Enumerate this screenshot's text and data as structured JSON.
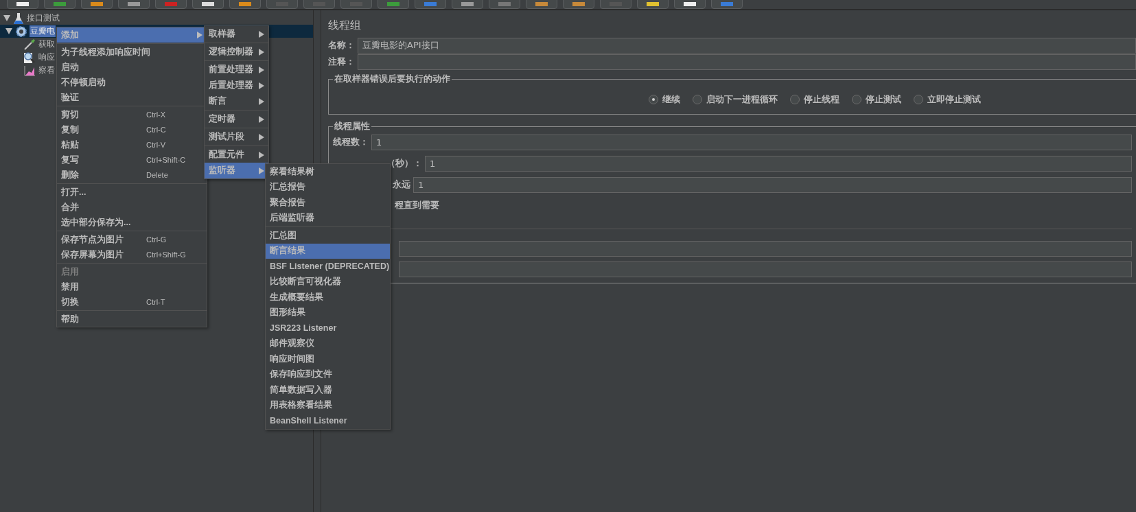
{
  "tree": {
    "root": {
      "label": "接口测试",
      "expanded": true,
      "children": [
        {
          "label": "豆瓣电",
          "selected": true,
          "expanded": true,
          "kind": "gear",
          "children": [
            {
              "label": "获取",
              "kind": "pipette",
              "selected": false
            },
            {
              "label": "响应",
              "kind": "magnifier",
              "selected": false
            },
            {
              "label": "察看",
              "kind": "graph",
              "selected": false
            }
          ]
        }
      ]
    }
  },
  "context_menu": {
    "groups": [
      [
        {
          "label": "添加",
          "has_submenu": true,
          "selected": true,
          "disabled": false
        }
      ],
      [
        {
          "label": "为子线程添加响应时间",
          "has_submenu": false,
          "selected": false,
          "disabled": false
        },
        {
          "label": "启动",
          "has_submenu": false,
          "selected": false,
          "disabled": false
        },
        {
          "label": "不停顿启动",
          "has_submenu": false,
          "selected": false,
          "disabled": false
        },
        {
          "label": "验证",
          "has_submenu": false,
          "selected": false,
          "disabled": false
        }
      ],
      [
        {
          "label": "剪切",
          "shortcut": "Ctrl-X",
          "has_submenu": false,
          "selected": false,
          "disabled": false
        },
        {
          "label": "复制",
          "shortcut": "Ctrl-C",
          "has_submenu": false,
          "selected": false,
          "disabled": false
        },
        {
          "label": "粘贴",
          "shortcut": "Ctrl-V",
          "has_submenu": false,
          "selected": false,
          "disabled": false
        },
        {
          "label": "复写",
          "shortcut": "Ctrl+Shift-C",
          "has_submenu": false,
          "selected": false,
          "disabled": false
        },
        {
          "label": "删除",
          "shortcut": "Delete",
          "has_submenu": false,
          "selected": false,
          "disabled": false
        }
      ],
      [
        {
          "label": "打开...",
          "has_submenu": false,
          "selected": false,
          "disabled": false
        },
        {
          "label": "合并",
          "has_submenu": false,
          "selected": false,
          "disabled": false
        },
        {
          "label": "选中部分保存为...",
          "has_submenu": false,
          "selected": false,
          "disabled": false
        }
      ],
      [
        {
          "label": "保存节点为图片",
          "shortcut": "Ctrl-G",
          "has_submenu": false,
          "selected": false,
          "disabled": false
        },
        {
          "label": "保存屏幕为图片",
          "shortcut": "Ctrl+Shift-G",
          "has_submenu": false,
          "selected": false,
          "disabled": false
        }
      ],
      [
        {
          "label": "启用",
          "has_submenu": false,
          "selected": false,
          "disabled": true
        },
        {
          "label": "禁用",
          "has_submenu": false,
          "selected": false,
          "disabled": false
        },
        {
          "label": "切换",
          "shortcut": "Ctrl-T",
          "has_submenu": false,
          "selected": false,
          "disabled": false
        }
      ],
      [
        {
          "label": "帮助",
          "has_submenu": false,
          "selected": false,
          "disabled": false
        }
      ]
    ]
  },
  "add_submenu": {
    "groups": [
      [
        {
          "label": "取样器",
          "has_submenu": true,
          "selected": false
        }
      ],
      [
        {
          "label": "逻辑控制器",
          "has_submenu": true,
          "selected": false
        }
      ],
      [
        {
          "label": "前置处理器",
          "has_submenu": true,
          "selected": false
        },
        {
          "label": "后置处理器",
          "has_submenu": true,
          "selected": false
        },
        {
          "label": "断言",
          "has_submenu": true,
          "selected": false
        }
      ],
      [
        {
          "label": "定时器",
          "has_submenu": true,
          "selected": false
        }
      ],
      [
        {
          "label": "测试片段",
          "has_submenu": true,
          "selected": false
        }
      ],
      [
        {
          "label": "配置元件",
          "has_submenu": true,
          "selected": false
        },
        {
          "label": "监听器",
          "has_submenu": true,
          "selected": true
        }
      ]
    ]
  },
  "listener_submenu": {
    "groups": [
      [
        {
          "label": "察看结果树",
          "selected": false
        },
        {
          "label": "汇总报告",
          "selected": false
        },
        {
          "label": "聚合报告",
          "selected": false
        },
        {
          "label": "后端监听器",
          "selected": false
        }
      ],
      [
        {
          "label": "汇总图",
          "selected": false
        },
        {
          "label": "断言结果",
          "selected": true
        },
        {
          "label": "BSF Listener (DEPRECATED)",
          "selected": false
        },
        {
          "label": "比较断言可视化器",
          "selected": false
        },
        {
          "label": "生成概要结果",
          "selected": false
        },
        {
          "label": "图形结果",
          "selected": false
        },
        {
          "label": "JSR223 Listener",
          "selected": false
        },
        {
          "label": "邮件观察仪",
          "selected": false
        },
        {
          "label": "响应时间图",
          "selected": false
        },
        {
          "label": "保存响应到文件",
          "selected": false
        },
        {
          "label": "简单数据写入器",
          "selected": false
        },
        {
          "label": "用表格察看结果",
          "selected": false
        },
        {
          "label": "BeanShell Listener",
          "selected": false
        }
      ]
    ]
  },
  "panel": {
    "title": "线程组",
    "name_label": "名称：",
    "name_value": "豆瓣电影的API接口",
    "comment_label": "注释：",
    "error_action": {
      "legend": "在取样器错误后要执行的动作",
      "options": [
        {
          "label": "继续",
          "selected": true
        },
        {
          "label": "启动下一进程循环",
          "selected": false
        },
        {
          "label": "停止线程",
          "selected": false
        },
        {
          "label": "停止测试",
          "selected": false
        },
        {
          "label": "立即停止测试",
          "selected": false
        }
      ]
    },
    "thread_props": {
      "legend": "线程属性",
      "threads_label": "线程数：",
      "threads_value": "1",
      "rampup_label": "（秒）：",
      "rampup_value": "1",
      "loop_label": "永远",
      "loop_value": "1",
      "delay_label": "程直到需要"
    }
  }
}
